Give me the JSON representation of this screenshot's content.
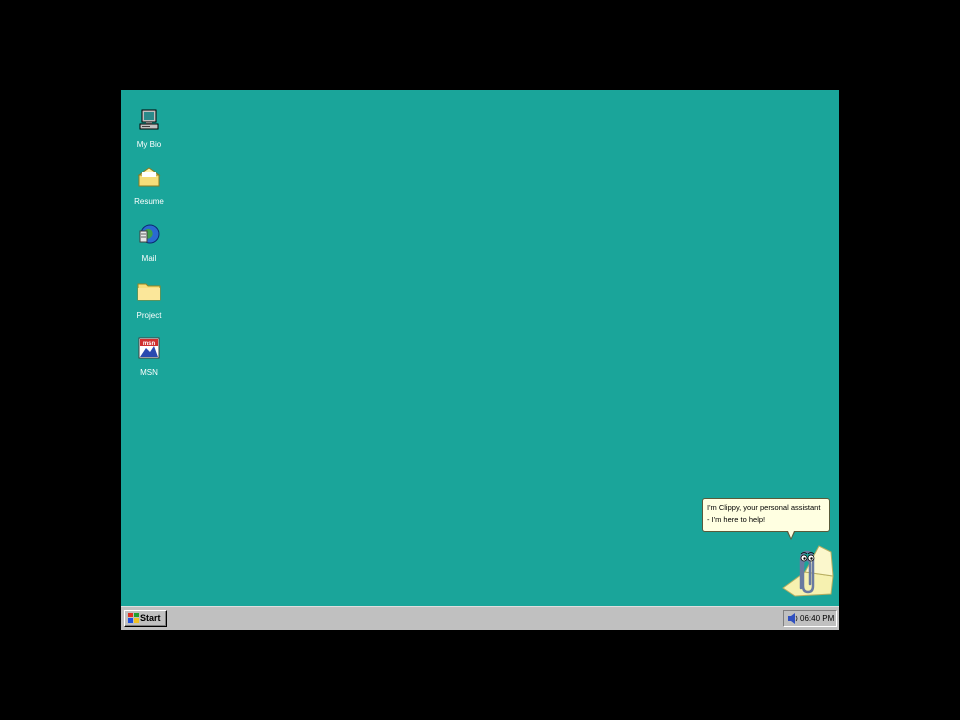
{
  "desktop": {
    "background_color": "#1aa59a",
    "icons": [
      {
        "label": "My Bio",
        "icon": "computer-icon"
      },
      {
        "label": "Resume",
        "icon": "open-folder-icon"
      },
      {
        "label": "Mail",
        "icon": "mail-globe-icon"
      },
      {
        "label": "Project",
        "icon": "folder-icon"
      },
      {
        "label": "MSN",
        "icon": "msn-icon"
      }
    ]
  },
  "assistant": {
    "message_line1": "I'm Clippy, your personal assistant",
    "message_line2": "- I'm here to help!",
    "icon": "paperclip-icon"
  },
  "taskbar": {
    "start_label": "Start",
    "clock": "06:40 PM",
    "tray_icon": "volume-icon"
  }
}
